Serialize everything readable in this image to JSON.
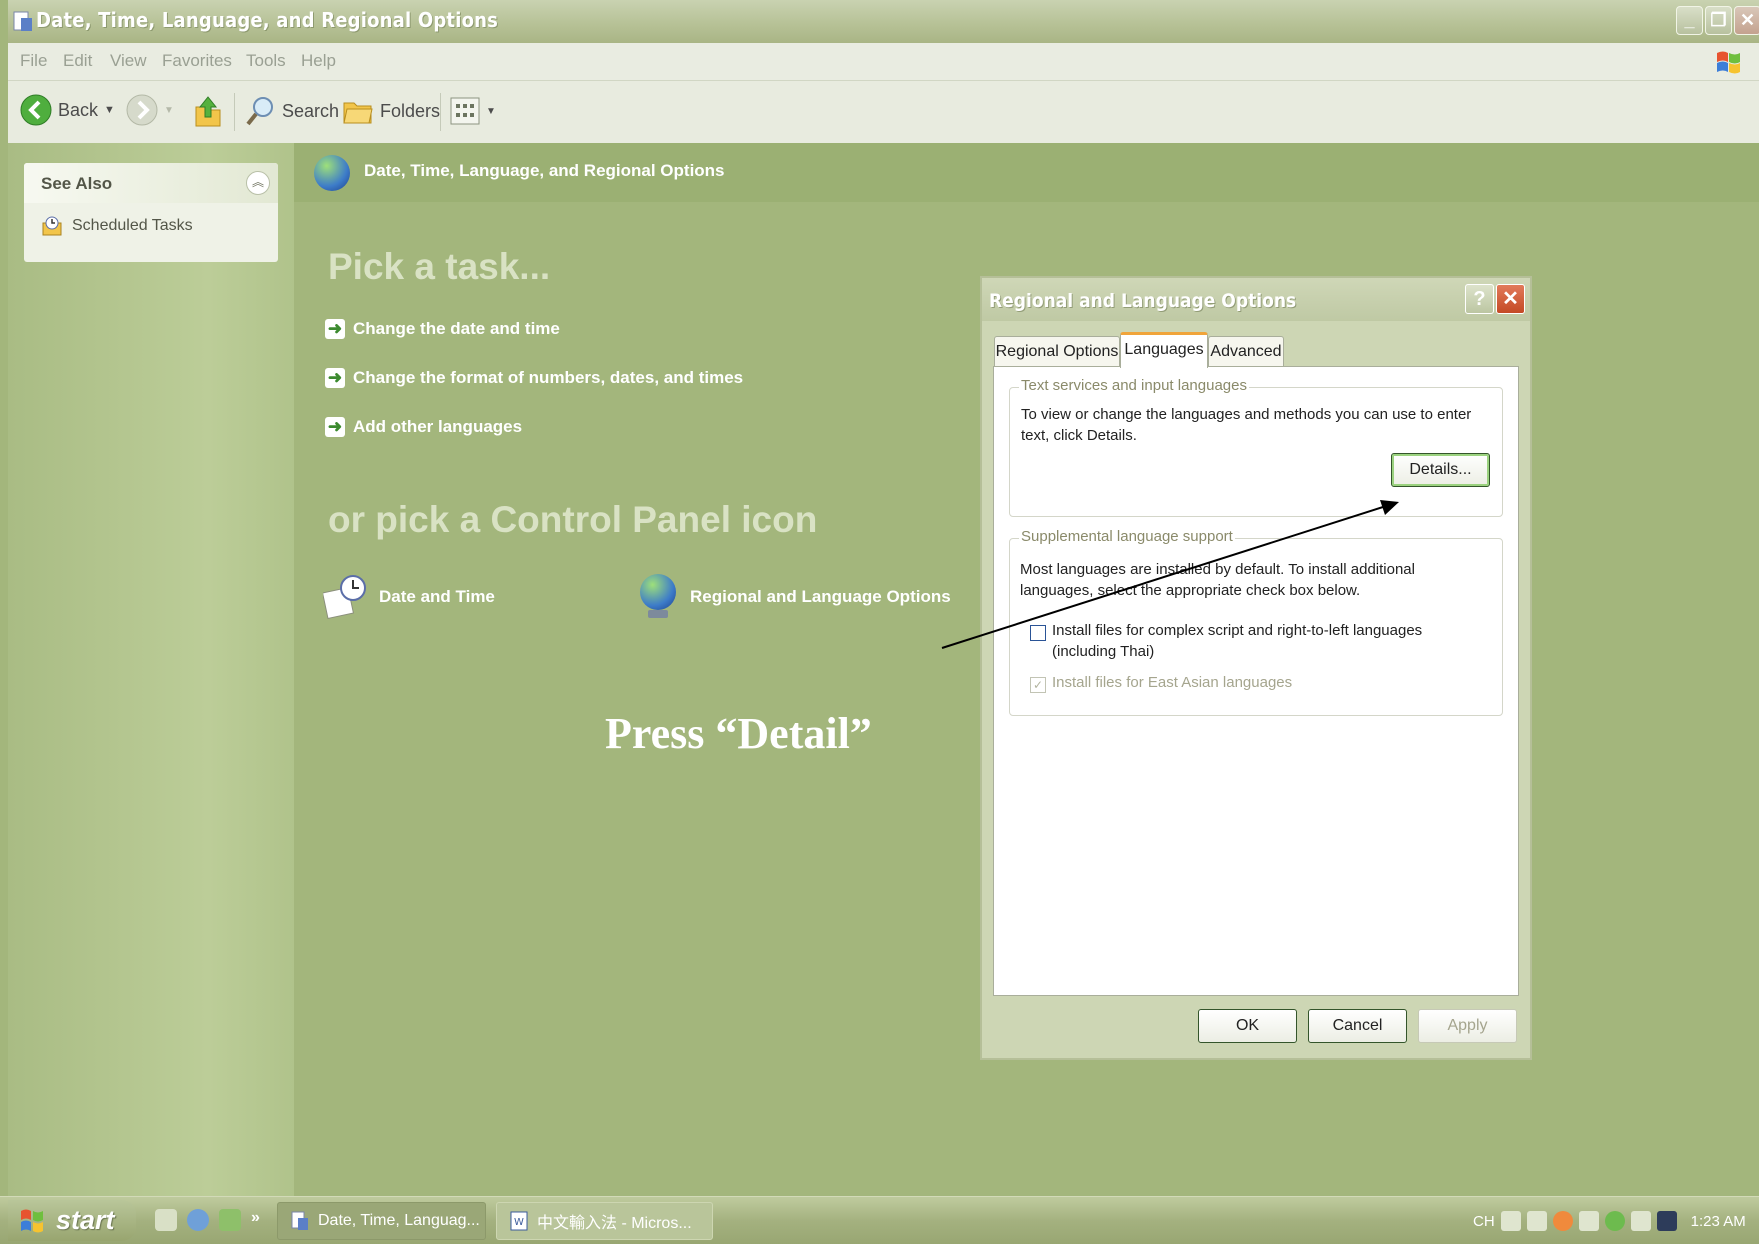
{
  "window": {
    "title": "Date, Time, Language, and Regional Options",
    "buttons": {
      "minimize": "_",
      "restore": "❐",
      "close": "✕"
    }
  },
  "menu": [
    "File",
    "Edit",
    "View",
    "Favorites",
    "Tools",
    "Help"
  ],
  "toolbar": {
    "back_label": "Back",
    "search_label": "Search",
    "folders_label": "Folders"
  },
  "see_also": {
    "title": "See Also",
    "items": [
      {
        "label": "Scheduled Tasks",
        "icon": "scheduled-tasks-icon"
      }
    ]
  },
  "header": {
    "title": "Date, Time, Language, and Regional Options"
  },
  "main": {
    "pick_task": "Pick a task...",
    "tasks": [
      "Change the date and time",
      "Change the format of numbers, dates, and times",
      "Add other languages"
    ],
    "pick_icon": "or pick a Control Panel icon",
    "icons": [
      {
        "label": "Date and Time",
        "icon": "date-time-icon"
      },
      {
        "label": "Regional and Language Options",
        "icon": "globe-icon"
      }
    ]
  },
  "annotation": "Press “Detail”",
  "dialog": {
    "title": "Regional and Language Options",
    "help": "?",
    "close": "✕",
    "tabs": [
      "Regional Options",
      "Languages",
      "Advanced"
    ],
    "active_tab": "Languages",
    "text_services": {
      "legend": "Text services and input languages",
      "text": "To view or change the languages and methods you can use to enter text, click Details.",
      "button": "Details..."
    },
    "supplemental": {
      "legend": "Supplemental language support",
      "text": "Most languages are installed by default. To install additional languages, select the appropriate check box below.",
      "checkbox1": {
        "label": "Install files for complex script and right-to-left languages (including Thai)",
        "checked": false
      },
      "checkbox2": {
        "label": "Install files for East Asian languages",
        "checked": true,
        "disabled": true
      }
    },
    "buttons": {
      "ok": "OK",
      "cancel": "Cancel",
      "apply": "Apply"
    }
  },
  "taskbar": {
    "start": "start",
    "chevron": "»",
    "tasks": [
      "Date, Time, Languag...",
      "中文輸入法 - Micros..."
    ],
    "tray_lang": "CH",
    "clock": "1:23 AM"
  }
}
